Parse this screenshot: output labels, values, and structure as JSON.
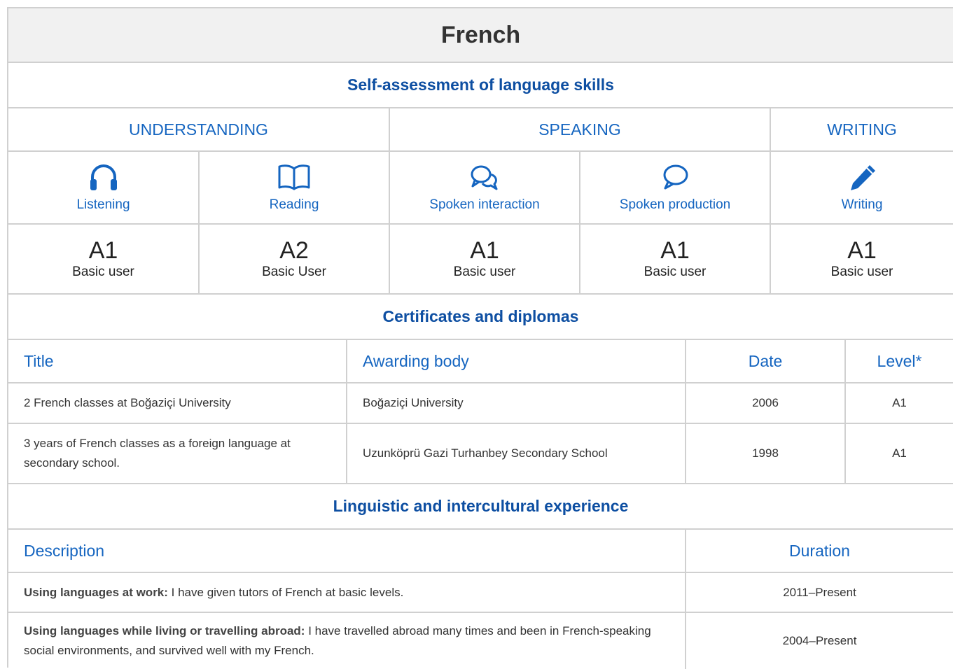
{
  "language": "French",
  "self_assessment": {
    "heading": "Self-assessment of language skills",
    "groups": [
      "UNDERSTANDING",
      "SPEAKING",
      "WRITING"
    ],
    "skills": [
      {
        "icon": "headphones-icon",
        "label": "Listening",
        "level": "A1",
        "level_desc": "Basic user"
      },
      {
        "icon": "open-book-icon",
        "label": "Reading",
        "level": "A2",
        "level_desc": "Basic User"
      },
      {
        "icon": "chat-bubbles-icon",
        "label": "Spoken interaction",
        "level": "A1",
        "level_desc": "Basic user"
      },
      {
        "icon": "speech-bubble-icon",
        "label": "Spoken production",
        "level": "A1",
        "level_desc": "Basic user"
      },
      {
        "icon": "pencil-icon",
        "label": "Writing",
        "level": "A1",
        "level_desc": "Basic user"
      }
    ]
  },
  "certificates": {
    "heading": "Certificates and diplomas",
    "columns": [
      "Title",
      "Awarding body",
      "Date",
      "Level*"
    ],
    "rows": [
      {
        "title": "2 French classes at Boğaziçi University",
        "body": "Boğaziçi University",
        "date": "2006",
        "level": "A1"
      },
      {
        "title": "3 years of French classes as a foreign language at secondary school.",
        "body": "Uzunköprü Gazi Turhanbey Secondary School",
        "date": "1998",
        "level": "A1"
      }
    ]
  },
  "experience": {
    "heading": "Linguistic and intercultural experience",
    "columns": [
      "Description",
      "Duration"
    ],
    "rows": [
      {
        "label": "Using languages at work:",
        "text": " I have given tutors of French at basic levels.",
        "duration": "2011–Present"
      },
      {
        "label": "Using languages while living or travelling abroad:",
        "text": " I have travelled abroad many times and been in French-speaking social environments, and survived well with my French.",
        "duration": "2004–Present"
      }
    ]
  },
  "colors": {
    "accent": "#1565c0",
    "heading": "#0e4fa2",
    "border": "#d0d0d0",
    "title_bg": "#f1f1f1"
  }
}
